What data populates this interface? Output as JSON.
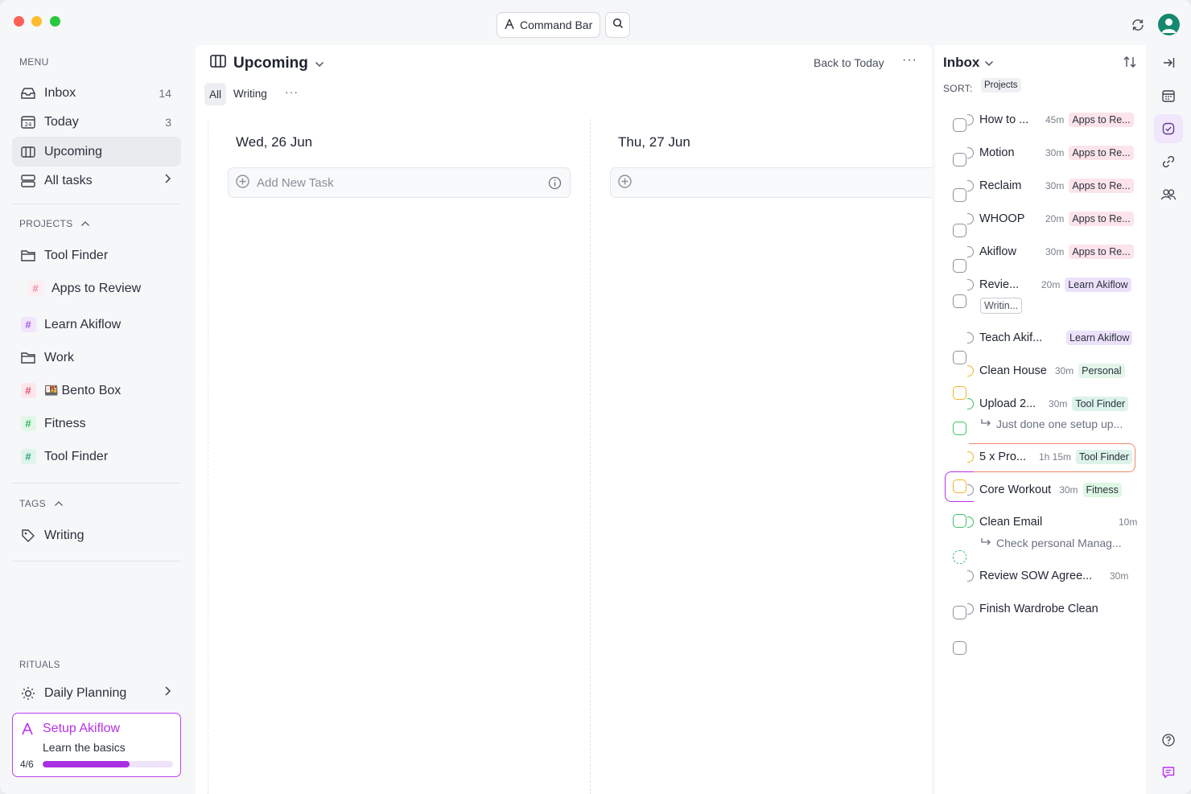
{
  "titlebar": {
    "command_bar_label": "Command Bar"
  },
  "sidebar": {
    "menu_label": "MENU",
    "menu_items": [
      {
        "label": "Inbox",
        "count": "14"
      },
      {
        "label": "Today",
        "count": "3"
      },
      {
        "label": "Upcoming"
      },
      {
        "label": "All tasks"
      }
    ],
    "today_icon_text": "24",
    "projects_label": "PROJECTS",
    "projects": [
      {
        "label": "Tool Finder",
        "kind": "folder"
      },
      {
        "label": "Apps to Review",
        "color": "#f3a7b8"
      },
      {
        "label": "Learn Akiflow",
        "color": "#a86ae8"
      },
      {
        "label": "Work",
        "kind": "folder"
      },
      {
        "label": "Bento Box",
        "emoji": "🍱",
        "color": "#e85b7e"
      },
      {
        "label": "Fitness",
        "color": "#3cbf66"
      },
      {
        "label": "Tool Finder",
        "color": "#2fb58a"
      }
    ],
    "tags_label": "TAGS",
    "tags": [
      {
        "label": "Writing"
      }
    ],
    "rituals_label": "RITUALS",
    "rituals": [
      {
        "label": "Daily Planning"
      }
    ],
    "setup": {
      "title": "Setup Akiflow",
      "subtitle": "Learn the basics",
      "progress_text": "4/6",
      "progress": 0.6667
    }
  },
  "main": {
    "title": "Upcoming",
    "back_to_today": "Back to Today",
    "more": "···",
    "filters": {
      "all": "All",
      "writing": "Writing",
      "more": "···"
    },
    "days": [
      {
        "title": "Wed, 26 Jun",
        "add_placeholder": "Add New Task"
      },
      {
        "title": "Thu, 27 Jun",
        "add_placeholder": ""
      }
    ]
  },
  "inbox": {
    "title": "Inbox",
    "sort_label": "SORT:",
    "sort_value": "Projects",
    "tasks": [
      {
        "title": "How to ...",
        "duration": "45m",
        "tag": "Apps to Re...",
        "tag_style": "apps"
      },
      {
        "title": "Motion",
        "duration": "30m",
        "tag": "Apps to Re...",
        "tag_style": "apps"
      },
      {
        "title": "Reclaim",
        "duration": "30m",
        "tag": "Apps to Re...",
        "tag_style": "apps"
      },
      {
        "title": "WHOOP",
        "duration": "20m",
        "tag": "Apps to Re...",
        "tag_style": "apps"
      },
      {
        "title": "Akiflow",
        "duration": "30m",
        "tag": "Apps to Re...",
        "tag_style": "apps"
      },
      {
        "title": "Revie...",
        "duration": "20m",
        "tag": "Learn Akiflow",
        "tag_style": "learn",
        "extra_tag": "Writin..."
      },
      {
        "title": "Teach Akif...",
        "duration": "",
        "tag": "Learn Akiflow",
        "tag_style": "learn"
      },
      {
        "title": "Clean House",
        "duration": "30m",
        "tag": "Personal",
        "tag_style": "personal"
      },
      {
        "title": "Upload 2...",
        "duration": "30m",
        "tag": "Tool Finder",
        "tag_style": "tool",
        "subtask": "Just done one setup up..."
      },
      {
        "title": "5 x Pro...",
        "duration": "1h 15m",
        "tag": "Tool Finder",
        "tag_style": "tool"
      },
      {
        "title": "Core Workout",
        "duration": "30m",
        "tag": "Fitness",
        "tag_style": "fitness"
      },
      {
        "title": "Clean Email",
        "duration": "10m",
        "tag": "",
        "subtask": "Check personal Manag..."
      },
      {
        "title": "Review SOW Agree...",
        "duration": "30m",
        "tag": ""
      },
      {
        "title": "Finish Wardrobe Clean",
        "duration": "",
        "tag": ""
      }
    ]
  },
  "colors": {
    "accent": "#a92fe0",
    "highlight_orange": "#f08a6a",
    "checkbox_yellow": "#f0b429",
    "checkbox_green": "#3cbf66"
  },
  "icons": [
    "search-icon",
    "sync-icon",
    "avatar-icon",
    "inbox-icon",
    "calendar-icon",
    "columns-icon",
    "stack-icon",
    "folder-icon",
    "tag-icon",
    "sun-icon",
    "akiflow-logo-icon",
    "chevron-down-icon",
    "sort-icon",
    "collapse-panel-icon",
    "check-circle-icon",
    "link-icon",
    "people-icon",
    "help-icon",
    "chat-icon",
    "plus-circle-icon",
    "info-icon"
  ]
}
